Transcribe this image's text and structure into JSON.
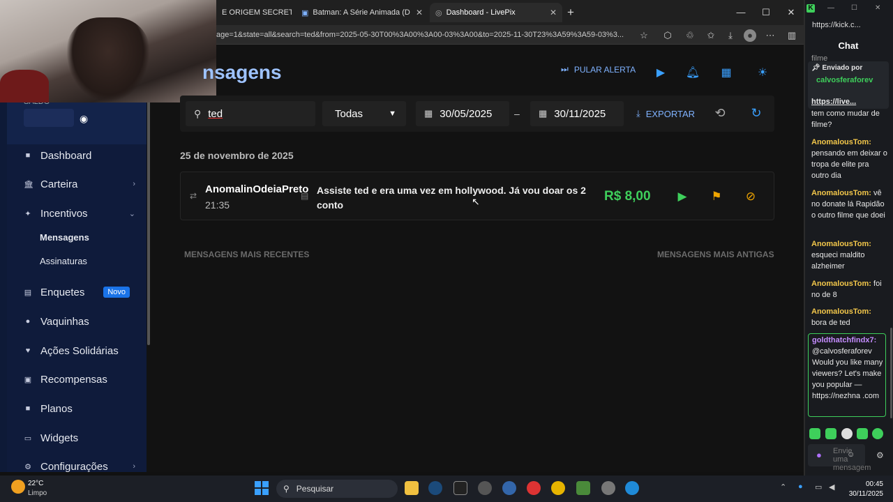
{
  "browser": {
    "tabs": [
      {
        "label": "E ORIGEM SECRETA D"
      },
      {
        "label": "Batman: A Série Animada (Dublad"
      },
      {
        "label": "Dashboard - LivePix"
      }
    ],
    "url": "age=1&state=all&search=ted&from=2025-05-30T00%3A00%3A00-03%3A00&to=2025-11-30T23%3A59%3A59-03%3..."
  },
  "sidebar": {
    "saldo_label": "SALDO",
    "items": [
      {
        "label": "Dashboard"
      },
      {
        "label": "Carteira"
      },
      {
        "label": "Incentivos"
      },
      {
        "label": "Mensagens"
      },
      {
        "label": "Assinaturas"
      },
      {
        "label": "Enquetes",
        "badge": "Novo"
      },
      {
        "label": "Vaquinhas"
      },
      {
        "label": "Ações Solidárias"
      },
      {
        "label": "Recompensas"
      },
      {
        "label": "Planos"
      },
      {
        "label": "Widgets"
      },
      {
        "label": "Configurações"
      }
    ]
  },
  "header": {
    "title": "nsagens",
    "skip_alert": "PULAR ALERTA"
  },
  "filters": {
    "search_value": "ted",
    "status_selected": "Todas",
    "date_from": "30/05/2025",
    "date_sep": "–",
    "date_to": "30/11/2025",
    "export_label": "EXPORTAR"
  },
  "messages": {
    "date_heading": "25 de novembro de 2025",
    "items": [
      {
        "user": "AnomalinOdeiaPreto",
        "time": "21:35",
        "text": "Assiste ted e era uma vez em hollywood. Já vou doar os 2 conto",
        "value": "R$ 8,00"
      }
    ],
    "newer_label": "MENSAGENS MAIS RECENTES",
    "older_label": "MENSAGENS MAIS ANTIGAS"
  },
  "chat": {
    "url": "https://kick.c...",
    "heading": "Chat",
    "top_partial": "filme",
    "pinned": {
      "label": "Enviado por",
      "user": "calvosferaforev",
      "link": "https://live..."
    },
    "lines": [
      {
        "user": "",
        "text": "tem como mudar de filme?"
      },
      {
        "user": "AnomalousTom:",
        "text": "pensando em deixar o tropa de elite pra outro dia"
      },
      {
        "user": "AnomalousTom:",
        "text": "vê no donate lá Rapidão o outro filme que doei"
      },
      {
        "user": "AnomalousTom:",
        "text": "esqueci maldito alzheimer"
      },
      {
        "user": "AnomalousTom:",
        "text": "foi no de 8"
      },
      {
        "user": "AnomalousTom:",
        "text": "bora de ted"
      }
    ],
    "spam": {
      "user": "goldthatchfindx7:",
      "text": "@calvosferaforev Would you like many viewers? Let's make you popular — https://nezhna .com"
    },
    "input_placeholder": "Envie uma mensagem"
  },
  "taskbar": {
    "temp": "22°C",
    "weather": "Limpo",
    "search_label": "Pesquisar",
    "time": "00:45",
    "date": "30/11/2025"
  },
  "colors": {
    "accent_blue": "#3aa0ff",
    "value_green": "#3ecf5b",
    "flag_orange": "#f0a500",
    "sidebar_bg": "#0f1b3b"
  }
}
